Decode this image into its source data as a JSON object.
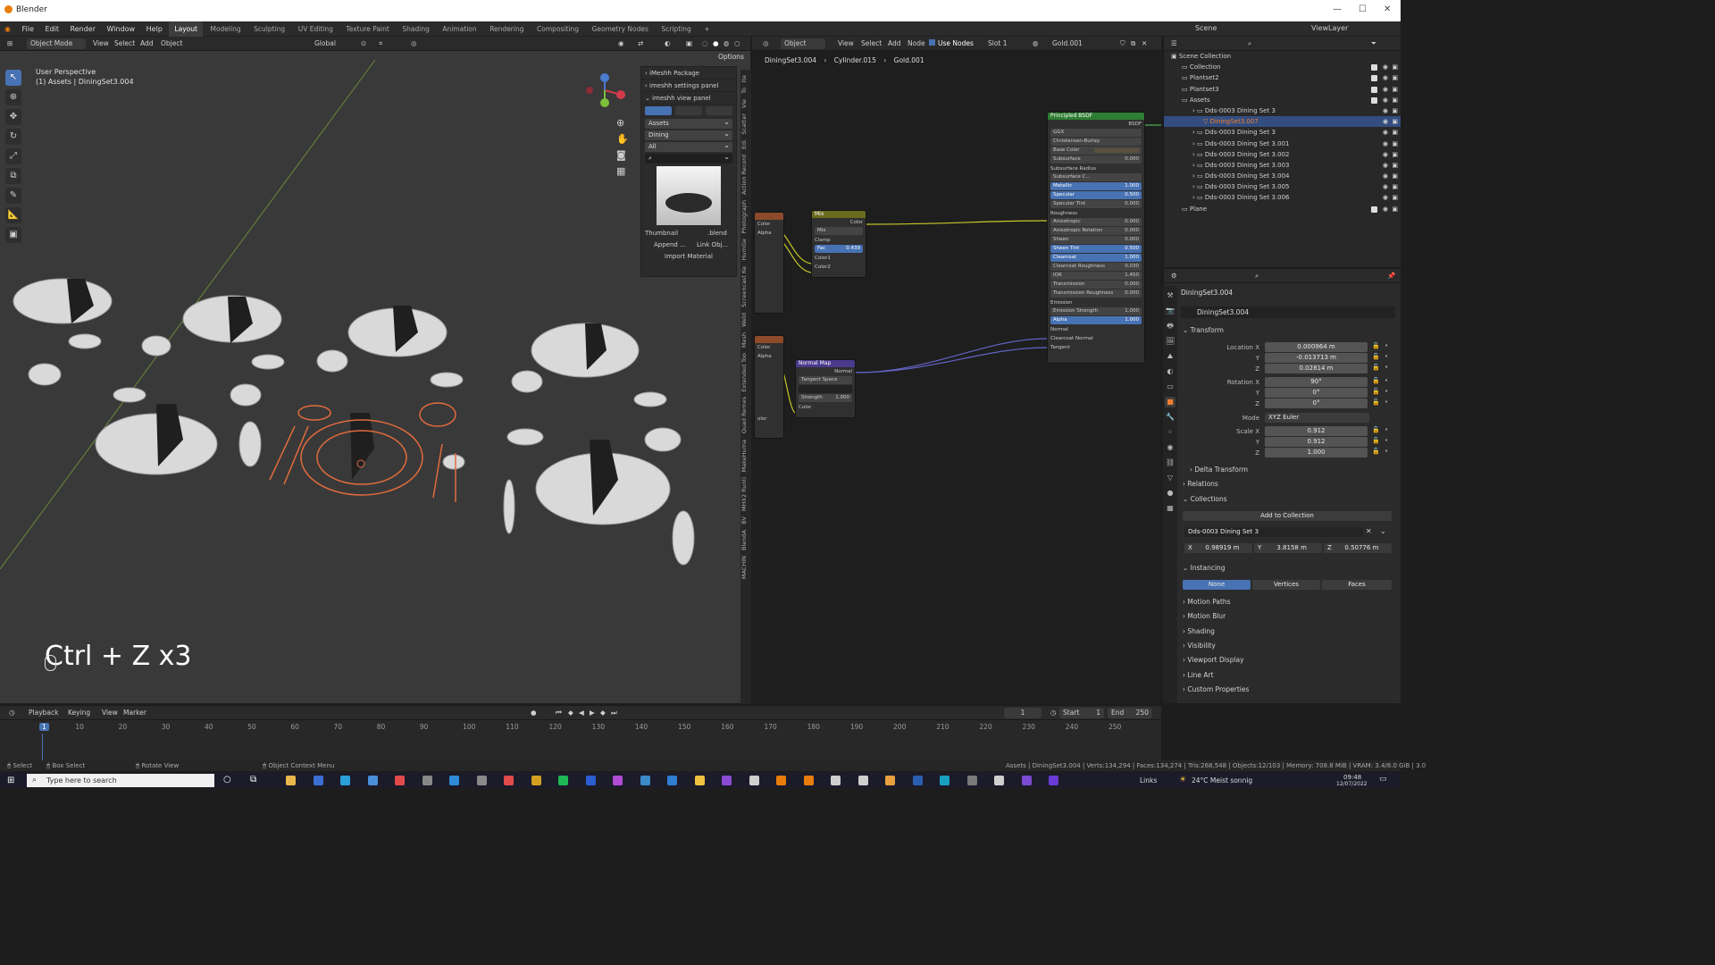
{
  "app": {
    "title": "Blender"
  },
  "menu": {
    "items": [
      "File",
      "Edit",
      "Render",
      "Window",
      "Help"
    ],
    "workspaces": [
      "Layout",
      "Modeling",
      "Sculpting",
      "UV Editing",
      "Texture Paint",
      "Shading",
      "Animation",
      "Rendering",
      "Compositing",
      "Geometry Nodes",
      "Scripting"
    ],
    "active_workspace": "Layout",
    "scene": "Scene",
    "view_layer": "ViewLayer"
  },
  "viewport": {
    "mode": "Object Mode",
    "menus": [
      "View",
      "Select",
      "Add",
      "Object"
    ],
    "orientation": "Global",
    "options": "Options",
    "perspective_label": "User Perspective",
    "collection_label": "(1) Assets | DiningSet3.004",
    "overlay_text": "Ctrl + Z x3"
  },
  "npanel": {
    "items": [
      "iMeshh Package",
      "imeshh settings panel",
      "imeshh view panel"
    ],
    "dropdowns": [
      "Assets",
      "Dining",
      "All"
    ],
    "thumbnail_label": "Thumbnail",
    "blend_label": ".blend",
    "append_label": "Append ...",
    "link_label": "Link Obj...",
    "import_label": "Import Material"
  },
  "vtabs": [
    "Ite",
    "To",
    "Vie",
    "Scatter",
    "Edi",
    "Action Record",
    "Photograph",
    "HumGe",
    "Screencast Ke",
    "Weld",
    "Mesh",
    "Extended Too",
    "Quad Remes",
    "MakeHuma",
    "MHX2 Runti",
    "BV",
    "BlendA",
    "MACHIN"
  ],
  "node_editor": {
    "menus": [
      "View",
      "Select",
      "Add",
      "Node"
    ],
    "object_label": "Object",
    "use_nodes_label": "Use Nodes",
    "slot": "Slot 1",
    "material": "Gold.001",
    "breadcrumb": [
      "DiningSet3.004",
      "Cylinder.015",
      "Gold.001"
    ]
  },
  "bsdf": {
    "title": "Principled BSDF",
    "out_label": "BSDF",
    "dist": "GGX",
    "sss": "Christensen-Burley",
    "base_color": "Base Color",
    "rows": [
      [
        "Subsurface",
        "0.000"
      ],
      [
        "Subsurface Radius",
        ""
      ],
      [
        "Subsurface C...",
        ""
      ],
      [
        "Metallic",
        "1.000"
      ],
      [
        "Specular",
        "0.500"
      ],
      [
        "Specular Tint",
        "0.000"
      ],
      [
        "Roughness",
        ""
      ],
      [
        "Anisotropic",
        "0.000"
      ],
      [
        "Anisotropic Rotation",
        "0.000"
      ],
      [
        "Sheen",
        "0.000"
      ],
      [
        "Sheen Tint",
        "0.500"
      ],
      [
        "Clearcoat",
        "1.000"
      ],
      [
        "Clearcoat Roughness",
        "0.030"
      ],
      [
        "IOR",
        "1.450"
      ],
      [
        "Transmission",
        "0.000"
      ],
      [
        "Transmission Roughness",
        "0.000"
      ],
      [
        "Emission",
        ""
      ],
      [
        "Emission Strength",
        "1.000"
      ],
      [
        "Alpha",
        "1.000"
      ],
      [
        "Normal",
        ""
      ],
      [
        "Clearcoat Normal",
        ""
      ],
      [
        "Tangent",
        ""
      ]
    ]
  },
  "mix": {
    "title": "Mix",
    "out": "Color",
    "mode": "Mix",
    "clamp": "Clamp",
    "fac_label": "Fac",
    "fac_value": "0.439",
    "c1": "Color1",
    "c2": "Color2"
  },
  "normalmap": {
    "title": "Normal Map",
    "out": "Normal",
    "space": "Tangent Space",
    "strength_label": "Strength",
    "strength_value": "1.000",
    "in": "Color"
  },
  "tex1": {
    "color": "Color",
    "alpha": "Alpha"
  },
  "tex2": {
    "color": "Color",
    "alpha": "Alpha",
    "extra": "olor"
  },
  "outliner": {
    "root": "Scene Collection",
    "rows": [
      {
        "label": "Collection",
        "indent": 1,
        "sel": false
      },
      {
        "label": "Plantset2",
        "indent": 1,
        "sel": false
      },
      {
        "label": "Plantset3",
        "indent": 1,
        "sel": false
      },
      {
        "label": "Assets",
        "indent": 1,
        "sel": false
      },
      {
        "label": "Dds-0003 Dining Set 3",
        "indent": 2,
        "sel": false
      },
      {
        "label": "DiningSet3.007",
        "indent": 3,
        "sel": true
      },
      {
        "label": "Dds-0003 Dining Set 3",
        "indent": 2,
        "sel": false
      },
      {
        "label": "Dds-0003 Dining Set 3.001",
        "indent": 2,
        "sel": false
      },
      {
        "label": "Dds-0003 Dining Set 3.002",
        "indent": 2,
        "sel": false
      },
      {
        "label": "Dds-0003 Dining Set 3.003",
        "indent": 2,
        "sel": false
      },
      {
        "label": "Dds-0003 Dining Set 3.004",
        "indent": 2,
        "sel": false
      },
      {
        "label": "Dds-0003 Dining Set 3.005",
        "indent": 2,
        "sel": false
      },
      {
        "label": "Dds-0003 Dining Set 3.006",
        "indent": 2,
        "sel": false
      },
      {
        "label": "Plane",
        "indent": 1,
        "sel": false
      }
    ]
  },
  "properties": {
    "object_name": "DiningSet3.004",
    "object_field": "DiningSet3.004",
    "transform": "Transform",
    "location_x_label": "Location X",
    "location_x": "0.000964 m",
    "location_y": "-0.013713 m",
    "location_z": "0.02814 m",
    "rotation_x_label": "Rotation X",
    "rotation_x": "90°",
    "rotation_y": "0°",
    "rotation_z": "0°",
    "mode_label": "Mode",
    "mode": "XYZ Euler",
    "scale_x_label": "Scale X",
    "scale_x": "0.912",
    "scale_y": "0.912",
    "scale_z": "1.000",
    "y_label": "Y",
    "z_label": "Z",
    "delta": "Delta Transform",
    "relations": "Relations",
    "collections": "Collections",
    "add_to_collection": "Add to Collection",
    "collection_name": "Dds-0003 Dining Set 3",
    "offset_x_label": "X",
    "offset_x": "0.98919 m",
    "offset_y_label": "Y",
    "offset_y": "3.8158 m",
    "offset_z_label": "Z",
    "offset_z": "0.50776 m",
    "instancing": "Instancing",
    "inst_none": "None",
    "inst_vertices": "Vertices",
    "inst_faces": "Faces",
    "sections": [
      "Motion Paths",
      "Motion Blur",
      "Shading",
      "Visibility",
      "Viewport Display",
      "Line Art",
      "Custom Properties"
    ]
  },
  "timeline": {
    "menus": [
      "Playback",
      "Keying",
      "View",
      "Marker"
    ],
    "current_frame": "1",
    "start_label": "Start",
    "start": "1",
    "end_label": "End",
    "end": "250",
    "ticks": [
      "1",
      "10",
      "20",
      "30",
      "40",
      "50",
      "60",
      "70",
      "80",
      "90",
      "100",
      "110",
      "120",
      "130",
      "140",
      "150",
      "160",
      "170",
      "180",
      "190",
      "200",
      "210",
      "220",
      "230",
      "240",
      "250"
    ]
  },
  "statusbar": {
    "select": "Select",
    "box_select": "Box Select",
    "rotate": "Rotate View",
    "context": "Object Context Menu",
    "stats": "Assets | DiningSet3.004 | Verts:134,294 | Faces:134,274 | Tris:268,548 | Objects:12/103 | Memory: 708.8 MiB | VRAM: 3.4/8.0 GiB | 3.0"
  },
  "taskbar": {
    "search_placeholder": "Type here to search",
    "links": "Links",
    "weather": "24°C  Meist sonnig",
    "time": "09:48",
    "date": "12/07/2022"
  }
}
